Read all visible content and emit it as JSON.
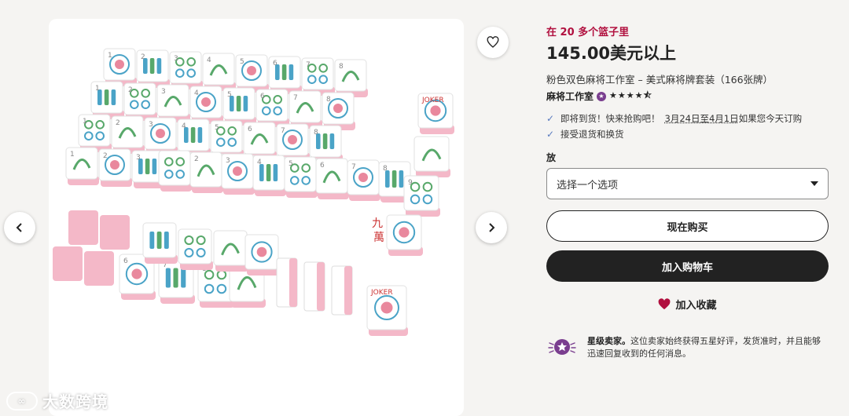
{
  "gallery": {
    "prev_icon": "chevron-left-icon",
    "next_icon": "chevron-right-icon",
    "favorite_icon": "heart-outline-icon",
    "watermark": "大数跨境",
    "tile_marks": [
      "1",
      "2",
      "3",
      "4",
      "5",
      "6",
      "7",
      "8",
      "9",
      "JOKER",
      "九",
      "萬"
    ]
  },
  "product": {
    "basket_notice": "在 20 多个篮子里",
    "price": "145.00美元以上",
    "title": "粉色双色麻将工作室 – 美式麻将牌套装（166张牌）",
    "shop_name": "麻将工作室",
    "rating": 4.5,
    "rating_stars": "★★★★⯪",
    "perks": {
      "arrival_prefix": "即将到货！快来抢购吧！",
      "arrival_dates": "3月24日至4月1日",
      "arrival_suffix": "如果您今天订购",
      "returns": "接受退货和换货"
    },
    "variant_label": "放",
    "variant_placeholder": "选择一个选项",
    "buy_now": "现在购买",
    "add_to_cart": "加入购物车",
    "add_to_collection": "加入收藏",
    "star_seller_title": "星级卖家。",
    "star_seller_desc": "这位卖家始终获得五星好评，发货准时，并且能够迅速回复收到的任何消息。"
  },
  "colors": {
    "accent": "#b1103f",
    "dark_button": "#222222",
    "tile_pink": "#f4b8c8",
    "star_seller_purple": "#7a3e8f"
  }
}
